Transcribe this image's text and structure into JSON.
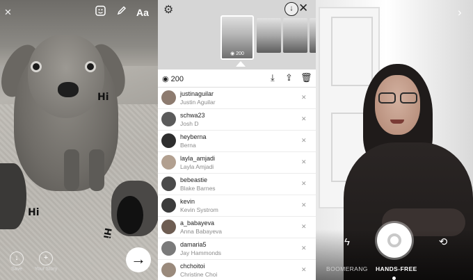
{
  "editor": {
    "stickers": [
      "Hi",
      "Hi",
      "Hi"
    ],
    "text_tool_label": "Aa",
    "save_label": "Save",
    "your_story_label": "Your Story",
    "next_glyph": "→"
  },
  "viewers": {
    "view_count": "200",
    "thumb_count": "200",
    "list": [
      {
        "username": "justinaguilar",
        "name": "Justin Aguilar",
        "color": "#8d7b6f"
      },
      {
        "username": "schwa23",
        "name": "Josh D",
        "color": "#5b5b5b"
      },
      {
        "username": "heyberna",
        "name": "Berna",
        "color": "#2e2e2e"
      },
      {
        "username": "layla_amjadi",
        "name": "Layla Amjadi",
        "color": "#b2a090"
      },
      {
        "username": "bebeastie",
        "name": "Blake Barnes",
        "color": "#4a4a4a"
      },
      {
        "username": "kevin",
        "name": "Kevin Systrom",
        "color": "#3b3b3b"
      },
      {
        "username": "a_babayeva",
        "name": "Anna Babayeva",
        "color": "#6e5d52"
      },
      {
        "username": "damaria5",
        "name": "Jay Hammonds",
        "color": "#7a7a7a"
      },
      {
        "username": "chchoitoi",
        "name": "Christine Choi",
        "color": "#9a8a7c"
      }
    ]
  },
  "camera": {
    "modes": [
      {
        "label": "BOOMERANG",
        "active": false
      },
      {
        "label": "HANDS-FREE",
        "active": true
      }
    ]
  }
}
